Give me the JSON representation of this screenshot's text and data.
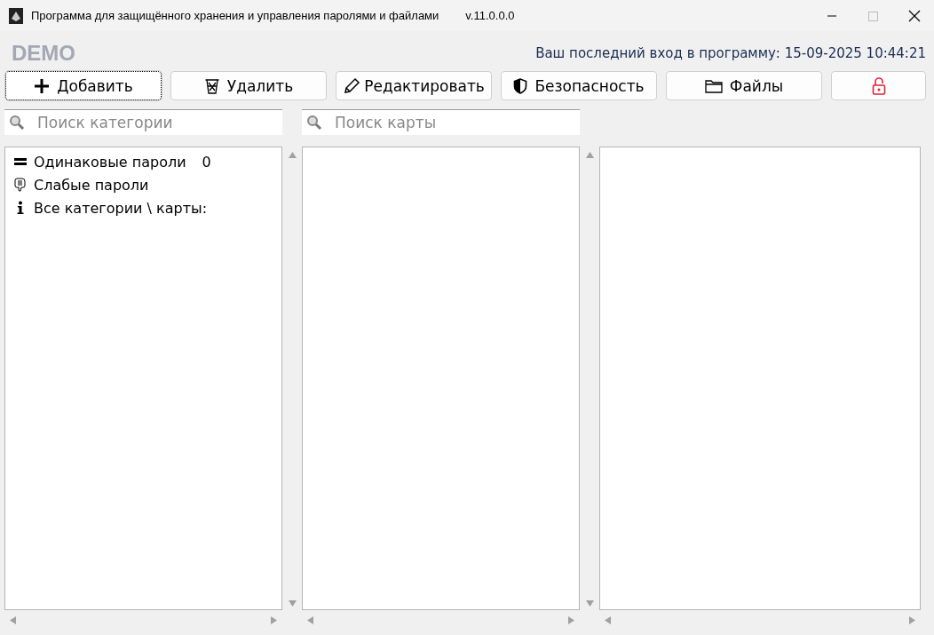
{
  "window": {
    "title": "Программа для защищённого хранения и управления паролями и файлами",
    "version": "v.11.0.0.0"
  },
  "header": {
    "badge": "DEMO",
    "last_login": "Ваш последний вход в программу: 15-09-2025 10:44:21"
  },
  "toolbar": [
    {
      "label": "Добавить",
      "focused": true
    },
    {
      "label": "Удалить",
      "focused": false
    },
    {
      "label": "Редактировать",
      "focused": false
    },
    {
      "label": "Безопасность",
      "focused": false
    },
    {
      "label": "Файлы",
      "focused": false
    },
    {
      "focused": false
    }
  ],
  "category_search": {
    "placeholder": "Поиск категории"
  },
  "card_search": {
    "placeholder": "Поиск карты"
  },
  "categories": [
    {
      "label": "Одинаковые пароли",
      "count": "0"
    },
    {
      "label": "Слабые пароли"
    },
    {
      "label": "Все категории \\ карты:"
    }
  ]
}
